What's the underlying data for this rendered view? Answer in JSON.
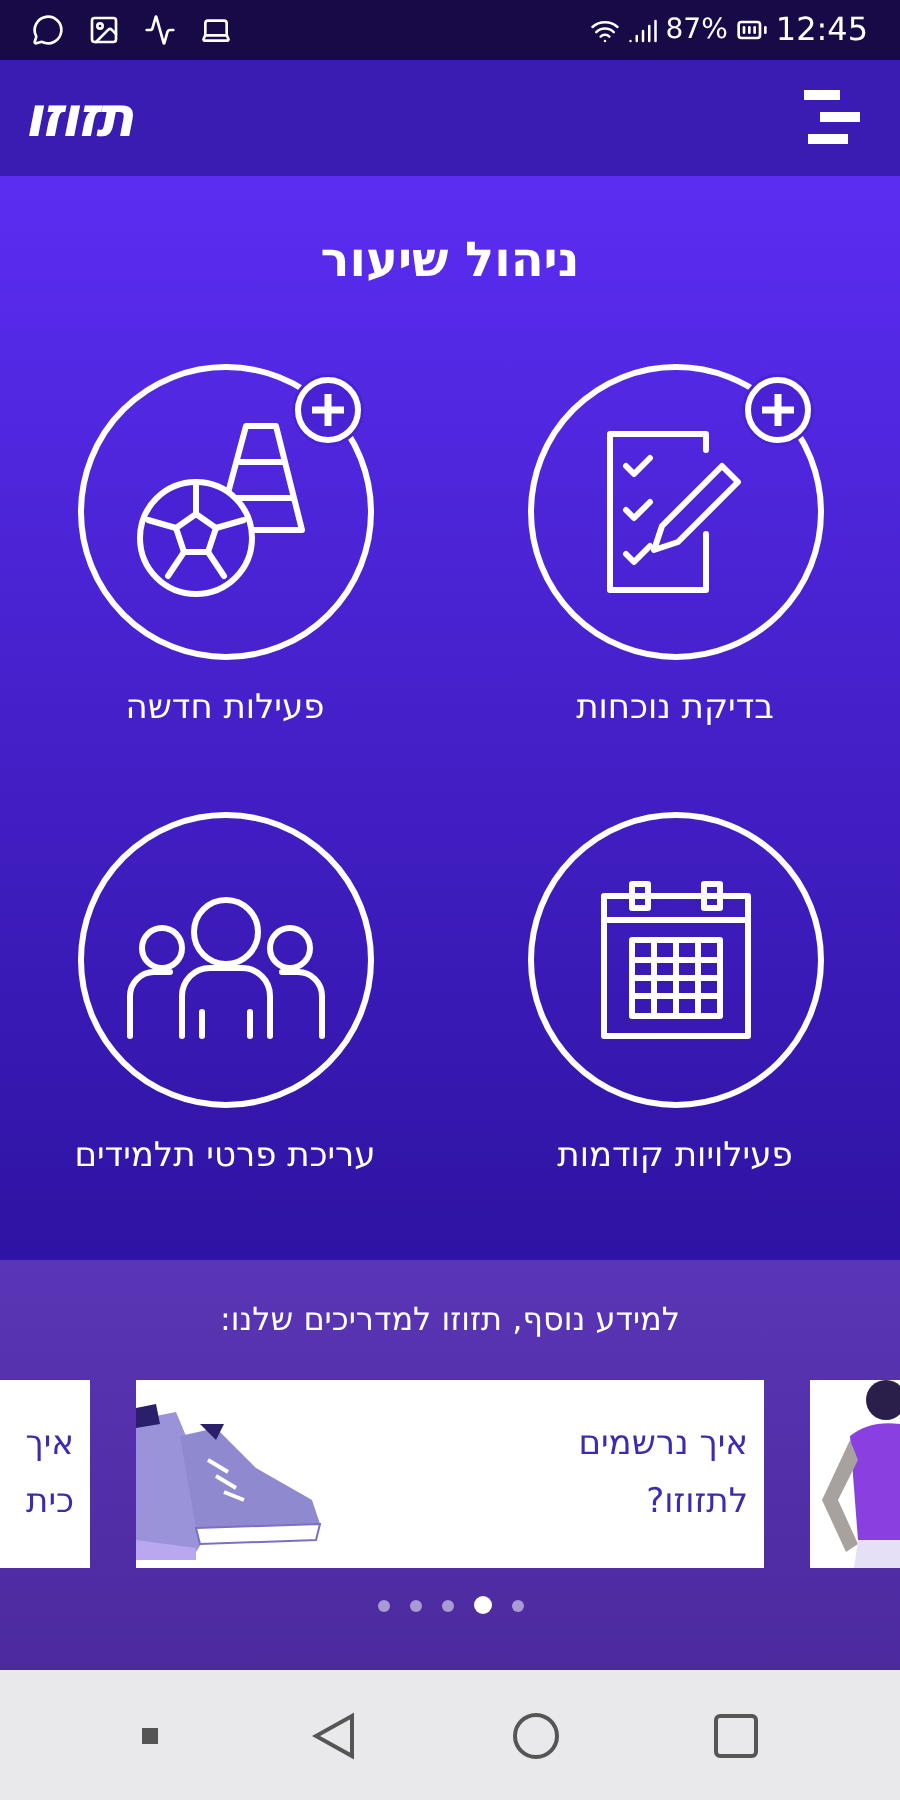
{
  "status_bar": {
    "battery": "87%",
    "time": "12:45"
  },
  "app_bar": {
    "logo": "תזוזו"
  },
  "title": "ניהול שיעור",
  "tiles": [
    {
      "label": "בדיקת נוכחות",
      "kind": "clipboard",
      "add": true
    },
    {
      "label": "פעילות חדשה",
      "kind": "ball",
      "add": true
    },
    {
      "label": "פעילויות קודמות",
      "kind": "calendar",
      "add": false
    },
    {
      "label": "עריכת פרטי תלמידים",
      "kind": "group",
      "add": false
    }
  ],
  "guides": {
    "heading": "למידע נוסף, תזוזו למדריכים שלנו:",
    "cards": [
      {
        "kind": "figure"
      },
      {
        "kind": "shoes",
        "lines": [
          "איך נרשמים",
          "לתזוזו?"
        ]
      },
      {
        "kind": "text",
        "lines": [
          "איך",
          "כית"
        ]
      }
    ],
    "dots": [
      {
        "selected": false
      },
      {
        "selected": false
      },
      {
        "selected": false
      },
      {
        "selected": true
      },
      {
        "selected": false
      }
    ]
  }
}
